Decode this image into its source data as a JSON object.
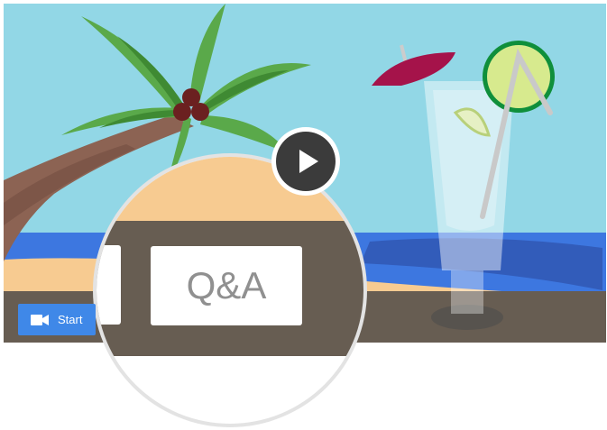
{
  "video": {
    "play_icon": "play-icon",
    "background_color": "#92d7e6"
  },
  "toolbar": {
    "start_label": "Start",
    "start_icon": "video-camera-icon",
    "accent_color": "#3f88e8"
  },
  "magnifier": {
    "qa_label": "Q&A"
  }
}
